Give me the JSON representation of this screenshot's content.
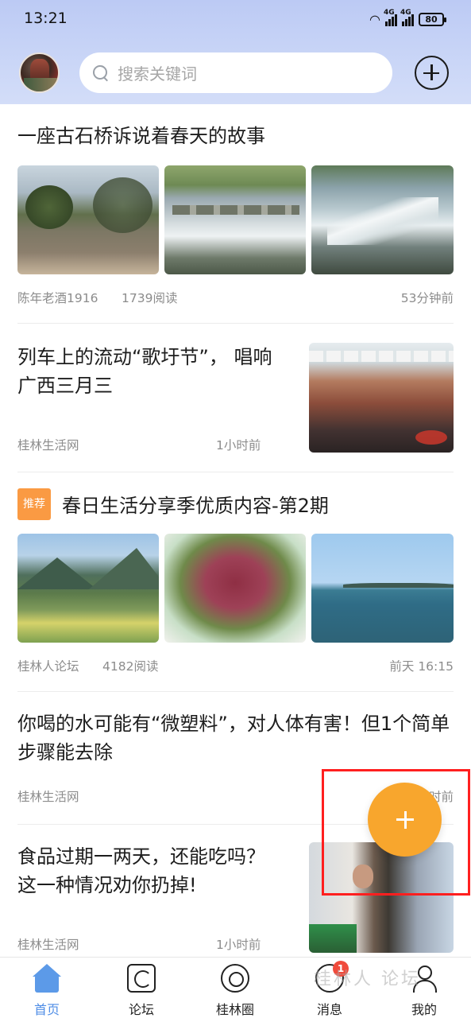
{
  "status_bar": {
    "time": "13:21",
    "network_1": "4G",
    "network_2": "4G",
    "battery": "80"
  },
  "header": {
    "search_placeholder": "搜索关键词",
    "avatar_icon": "user-avatar",
    "add_icon": "plus-circle-icon"
  },
  "feed": [
    {
      "title": "一座古石桥诉说着春天的故事",
      "source": "陈年老酒1916",
      "reads": "1739阅读",
      "time": "53分钟前"
    },
    {
      "title": "列车上的流动“歌圩节”， 唱响广西三月三",
      "source": "桂林生活网",
      "time": "1小时前"
    },
    {
      "tag": "推荐",
      "title": "春日生活分享季优质内容-第2期",
      "source": "桂林人论坛",
      "reads": "4182阅读",
      "time": "前天 16:15"
    },
    {
      "title": "你喝的水可能有“微塑料”，对人体有害！但1个简单步骤能去除",
      "source": "桂林生活网",
      "time": "时前"
    },
    {
      "title": "食品过期一两天，还能吃吗？这一种情况劝你扔掉!",
      "source": "桂林生活网",
      "time": "1小时前"
    }
  ],
  "tabbar": {
    "tabs": [
      {
        "label": "首页",
        "icon": "home-icon",
        "active": true
      },
      {
        "label": "论坛",
        "icon": "forum-icon"
      },
      {
        "label": "桂林圈",
        "icon": "circle-icon"
      },
      {
        "label": "消息",
        "icon": "message-icon",
        "badge": "1"
      },
      {
        "label": "我的",
        "icon": "profile-icon"
      }
    ]
  },
  "watermark": "桂林人 论坛",
  "colors": {
    "accent": "#4f8de6",
    "fab": "#f8a62d",
    "tag": "#fa9a43",
    "badge": "#f04b3c",
    "highlight": "#ff1f1f"
  }
}
